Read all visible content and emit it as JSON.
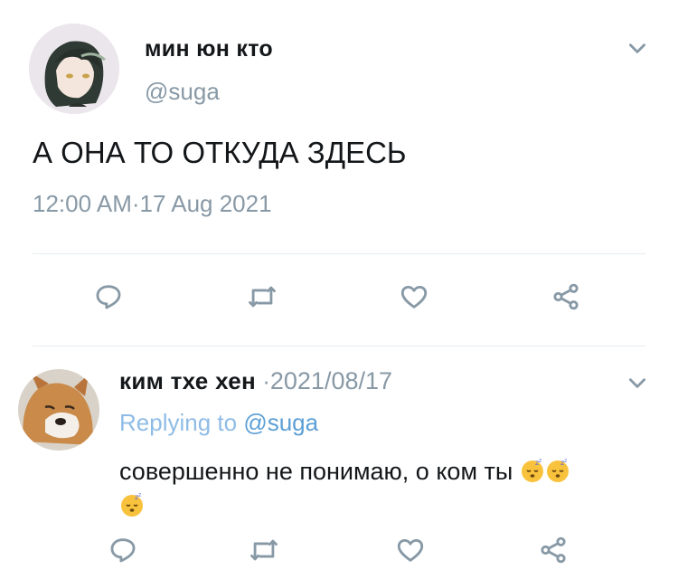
{
  "colors": {
    "accent": "#5c9fd6",
    "muted": "#8899a6",
    "divider": "#e6ecf0",
    "text": "#14171a"
  },
  "main_tweet": {
    "author_name": "мин юн кто",
    "author_handle": "@suga",
    "text": "А ОНА ТО ОТКУДА ЗДЕСЬ",
    "time": "12:00 AM",
    "separator": "·",
    "date": "17 Aug 2021",
    "actions": [
      "reply-icon",
      "retweet-icon",
      "like-icon",
      "share-icon"
    ]
  },
  "reply": {
    "author_name": "ким тхе хен",
    "separator": "·",
    "date": "2021/08/17",
    "replying_label": "Replying to",
    "replying_handle": "@suga",
    "text": "совершенно не понимаю, о ком ты",
    "emoji_name": "sleeping-face-emoji",
    "actions": [
      "reply-icon",
      "retweet-icon",
      "like-icon",
      "share-icon"
    ]
  }
}
